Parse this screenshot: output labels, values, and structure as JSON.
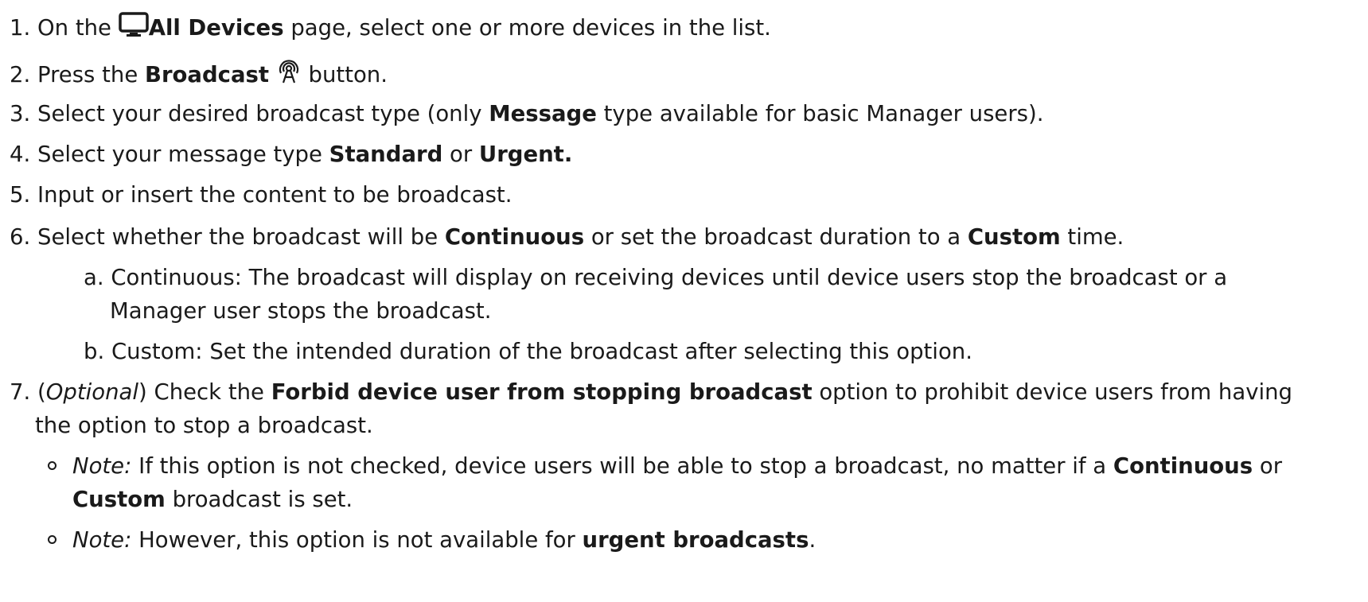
{
  "steps": [
    {
      "num": "1.",
      "pre": "On the",
      "icon": "monitor-icon",
      "bold": "All Devices",
      "post": " page, select one or more devices in the list."
    },
    {
      "num": "2.",
      "pre": "Press the ",
      "bold": "Broadcast",
      "icon": "broadcast-icon",
      "post": " button."
    },
    {
      "num": "3.",
      "pre": "Select your desired broadcast type (only ",
      "bold": "Message",
      "post": " type available for basic Manager users)."
    },
    {
      "num": "4.",
      "pre": "Select your message type ",
      "bold1": "Standard",
      "mid": " or ",
      "bold2": "Urgent."
    },
    {
      "num": "5.",
      "text": "Input or insert the content to be broadcast."
    },
    {
      "num": "6.",
      "pre": "Select whether the broadcast will be ",
      "bold1": "Continuous",
      "mid": " or set the broadcast duration to a ",
      "bold2": "Custom",
      "post": " time.",
      "substeps": [
        {
          "letter": "a.",
          "line1": "Continuous: The broadcast will display on receiving devices until device users stop the broadcast or a",
          "line2": "Manager user stops the broadcast."
        },
        {
          "letter": "b.",
          "line1": "Custom: Set the intended duration of the broadcast after selecting this option."
        }
      ]
    },
    {
      "num": "7.",
      "open": "(",
      "italic": "Optional",
      "close": ") Check the ",
      "bold": "Forbid device user from stopping broadcast",
      "post": " option to prohibit device users from having",
      "line2": "the option to stop a broadcast.",
      "notes": [
        {
          "label": "Note:",
          "pre": " If this option is not checked, device users will be able to stop a broadcast, no matter if a ",
          "bold1": "Continuous",
          "mid": " or",
          "bold2": "Custom",
          "post": " broadcast is set."
        },
        {
          "label": "Note:",
          "pre": " However, this option is not available for ",
          "bold": "urgent broadcasts",
          "post": "."
        }
      ]
    }
  ]
}
